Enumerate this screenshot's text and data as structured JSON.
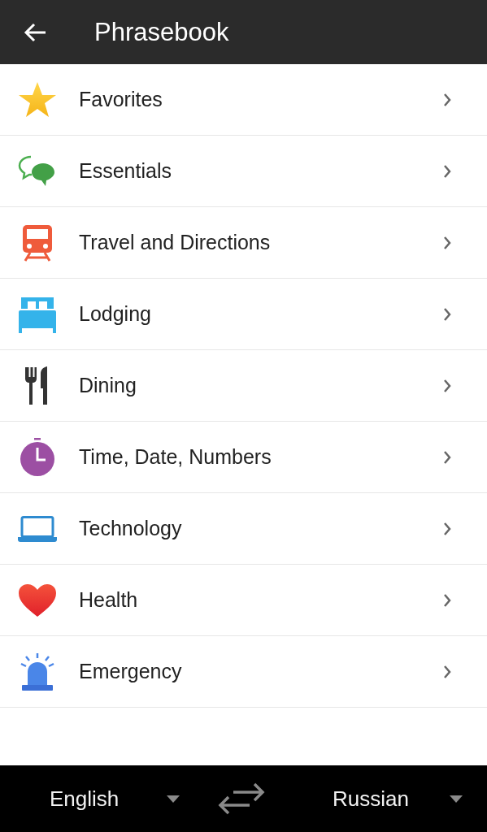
{
  "header": {
    "title": "Phrasebook"
  },
  "categories": [
    {
      "kind": "star",
      "label": "Favorites"
    },
    {
      "kind": "chat",
      "label": "Essentials"
    },
    {
      "kind": "train",
      "label": "Travel and Directions"
    },
    {
      "kind": "bed",
      "label": "Lodging"
    },
    {
      "kind": "cutlery",
      "label": "Dining"
    },
    {
      "kind": "timer",
      "label": "Time, Date, Numbers"
    },
    {
      "kind": "laptop",
      "label": "Technology"
    },
    {
      "kind": "heart",
      "label": "Health"
    },
    {
      "kind": "siren",
      "label": "Emergency"
    }
  ],
  "language_bar": {
    "source": "English",
    "target": "Russian"
  }
}
